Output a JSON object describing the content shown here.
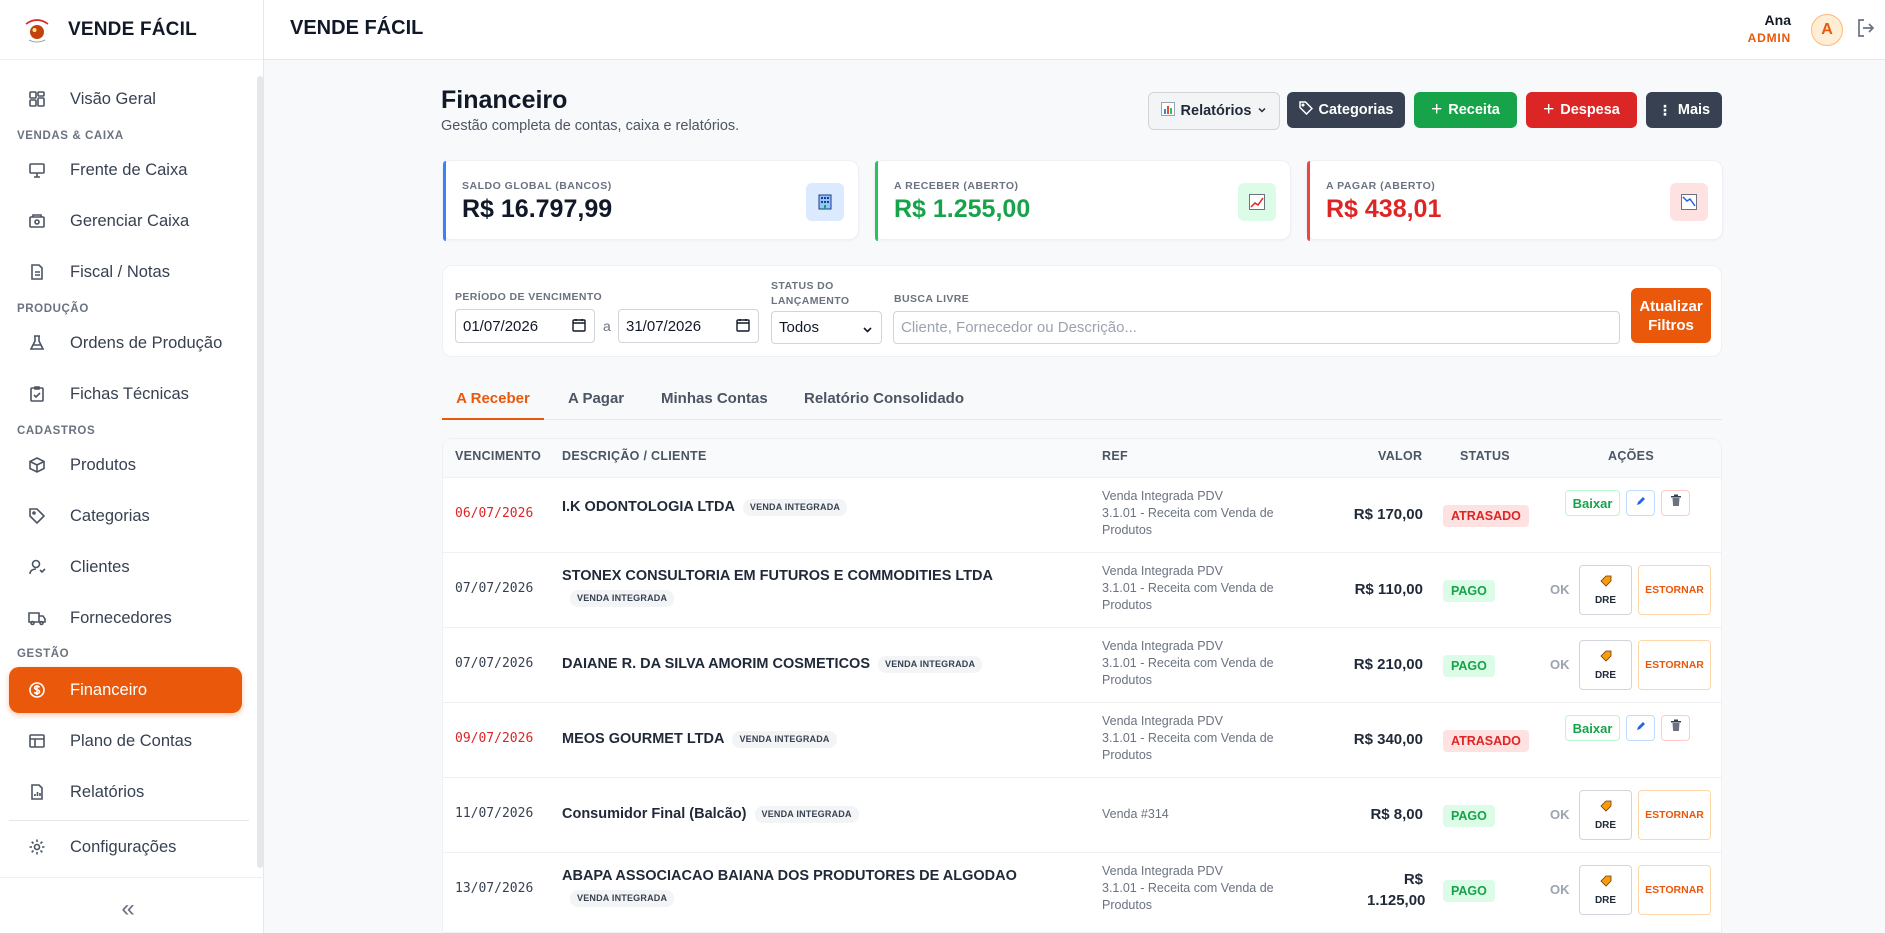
{
  "brand": {
    "name": "VENDE FÁCIL",
    "logo_text": "Vende Fácil"
  },
  "topbar": {
    "title": "VENDE FÁCIL",
    "user_name": "Ana",
    "user_role": "ADMIN",
    "avatar_letter": "A"
  },
  "sidebar": {
    "items": [
      {
        "label": "Visão Geral",
        "icon": "dashboard-icon"
      },
      {
        "section": "VENDAS & CAIXA"
      },
      {
        "label": "Frente de Caixa",
        "icon": "monitor-icon"
      },
      {
        "label": "Gerenciar Caixa",
        "icon": "cash-register-icon"
      },
      {
        "label": "Fiscal / Notas",
        "icon": "document-icon"
      },
      {
        "section": "PRODUÇÃO"
      },
      {
        "label": "Ordens de Produção",
        "icon": "flask-icon"
      },
      {
        "label": "Fichas Técnicas",
        "icon": "clipboard-check-icon"
      },
      {
        "section": "CADASTROS"
      },
      {
        "label": "Produtos",
        "icon": "package-icon"
      },
      {
        "label": "Categorias",
        "icon": "tag-icon"
      },
      {
        "label": "Clientes",
        "icon": "user-icon"
      },
      {
        "label": "Fornecedores",
        "icon": "truck-icon"
      },
      {
        "section": "GESTÃO"
      },
      {
        "label": "Financeiro",
        "icon": "dollar-circle-icon",
        "active": true
      },
      {
        "label": "Plano de Contas",
        "icon": "table-icon"
      },
      {
        "label": "Relatórios",
        "icon": "report-icon"
      },
      {
        "label": "Configurações",
        "icon": "gear-icon"
      }
    ],
    "collapse_label": "«"
  },
  "page": {
    "title": "Financeiro",
    "subtitle": "Gestão completa de contas, caixa e relatórios."
  },
  "toolbar": {
    "reports": "Relatórios",
    "categories": "Categorias",
    "income": "Receita",
    "expense": "Despesa",
    "more": "Mais"
  },
  "cards": [
    {
      "label": "SALDO GLOBAL (BANCOS)",
      "value": "R$ 16.797,99",
      "color": "#111827",
      "accent": "#3b82f6",
      "icon": "building-icon"
    },
    {
      "label": "A RECEBER (ABERTO)",
      "value": "R$ 1.255,00",
      "color": "#16a34a",
      "accent": "#22c55e",
      "icon": "trend-up-icon"
    },
    {
      "label": "A PAGAR (ABERTO)",
      "value": "R$ 438,01",
      "color": "#dc2626",
      "accent": "#ef4444",
      "icon": "trend-down-icon"
    }
  ],
  "filters": {
    "period_label": "PERÍODO DE VENCIMENTO",
    "date_from": "01/07/2026",
    "separator": "a",
    "date_to": "31/07/2026",
    "status_label_1": "STATUS DO",
    "status_label_2": "LANÇAMENTO",
    "status_value": "Todos",
    "search_label": "BUSCA LIVRE",
    "search_placeholder": "Cliente, Fornecedor ou Descrição...",
    "apply_line1": "Atualizar",
    "apply_line2": "Filtros"
  },
  "tabs": [
    "A Receber",
    "A Pagar",
    "Minhas Contas",
    "Relatório Consolidado"
  ],
  "table": {
    "headers": {
      "due": "VENCIMENTO",
      "desc": "DESCRIÇÃO / CLIENTE",
      "ref": "REF",
      "value": "VALOR",
      "status": "STATUS",
      "actions": "AÇÕES"
    },
    "tag": "VENDA INTEGRADA",
    "actions": {
      "settle": "Baixar",
      "ok": "OK",
      "dre": "DRE",
      "reverse": "ESTORNAR"
    },
    "rows": [
      {
        "due": "06/07/2026",
        "late": true,
        "desc": "I.K ODONTOLOGIA LTDA",
        "ref": [
          "Venda Integrada PDV",
          "3.1.01 - Receita com Venda de",
          "Produtos"
        ],
        "value": "R$ 170,00",
        "status": "ATRASADO"
      },
      {
        "due": "07/07/2026",
        "late": false,
        "desc": "STONEX CONSULTORIA EM FUTUROS E COMMODITIES LTDA",
        "ref": [
          "Venda Integrada PDV",
          "3.1.01 - Receita com Venda de",
          "Produtos"
        ],
        "value": "R$ 110,00",
        "status": "PAGO"
      },
      {
        "due": "07/07/2026",
        "late": false,
        "desc": "DAIANE R. DA SILVA AMORIM COSMETICOS",
        "ref": [
          "Venda Integrada PDV",
          "3.1.01 - Receita com Venda de",
          "Produtos"
        ],
        "value": "R$ 210,00",
        "status": "PAGO"
      },
      {
        "due": "09/07/2026",
        "late": true,
        "desc": "MEOS GOURMET LTDA",
        "ref": [
          "Venda Integrada PDV",
          "3.1.01 - Receita com Venda de",
          "Produtos"
        ],
        "value": "R$ 340,00",
        "status": "ATRASADO"
      },
      {
        "due": "11/07/2026",
        "late": false,
        "desc": "Consumidor Final (Balcão)",
        "ref": [
          "Venda #314"
        ],
        "value": "R$ 8,00",
        "status": "PAGO"
      },
      {
        "due": "13/07/2026",
        "late": false,
        "desc": "ABAPA ASSOCIACAO BAIANA DOS PRODUTORES DE ALGODAO",
        "ref": [
          "Venda Integrada PDV",
          "3.1.01 - Receita com Venda de",
          "Produtos"
        ],
        "value": "R$ 1.125,00",
        "status": "PAGO"
      }
    ]
  }
}
